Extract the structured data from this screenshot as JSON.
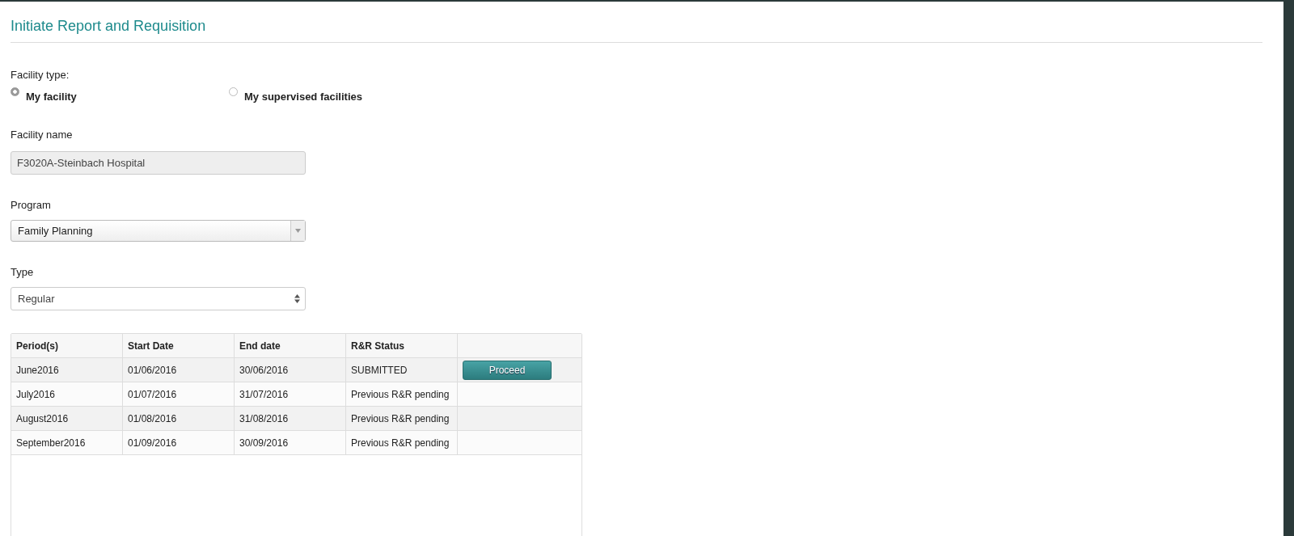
{
  "page_title": "Initiate Report and Requisition",
  "facility_type": {
    "label": "Facility type:",
    "options": [
      {
        "label": "My facility",
        "selected": true
      },
      {
        "label": "My supervised facilities",
        "selected": false
      }
    ]
  },
  "facility_name": {
    "label": "Facility name",
    "value": "F3020A-Steinbach Hospital",
    "disabled": true
  },
  "program": {
    "label": "Program",
    "value": "Family Planning"
  },
  "type": {
    "label": "Type",
    "value": "Regular"
  },
  "table": {
    "columns": [
      "Period(s)",
      "Start Date",
      "End date",
      "R&R Status"
    ],
    "rows": [
      {
        "cells": [
          "June2016",
          "01/06/2016",
          "30/06/2016",
          "SUBMITTED"
        ],
        "action": "Proceed"
      },
      {
        "cells": [
          "July2016",
          "01/07/2016",
          "31/07/2016",
          "Previous R&R pending"
        ]
      },
      {
        "cells": [
          "August2016",
          "01/08/2016",
          "31/08/2016",
          "Previous R&R pending"
        ]
      },
      {
        "cells": [
          "September2016",
          "01/09/2016",
          "30/09/2016",
          "Previous R&R pending"
        ]
      }
    ]
  }
}
